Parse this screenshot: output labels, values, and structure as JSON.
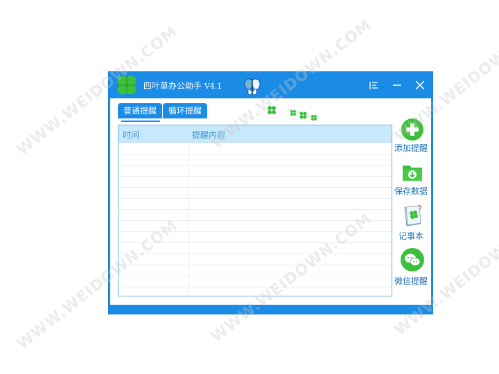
{
  "window": {
    "title": "四叶草办公助手",
    "version": "V4.1",
    "controls": {
      "menu_icon": "menu-lines-icon",
      "minimize_icon": "minimize-icon",
      "close_icon": "close-icon"
    }
  },
  "tabs": [
    {
      "label": "普通提醒",
      "active": true
    },
    {
      "label": "循环提醒",
      "active": false
    }
  ],
  "table": {
    "columns": [
      "时间",
      "提醒内容"
    ],
    "rows": []
  },
  "sidebar": [
    {
      "label": "添加提醒",
      "icon": "plus-circle-icon"
    },
    {
      "label": "保存数据",
      "icon": "folder-download-icon"
    },
    {
      "label": "记事本",
      "icon": "notebook-icon"
    },
    {
      "label": "微信提醒",
      "icon": "wechat-icon"
    }
  ],
  "watermark": "WWW.WEIDOWN.COM",
  "colors": {
    "accent": "#1a8ce6",
    "header_bg": "#c8e9fb",
    "green": "#3cbf3c",
    "label_blue": "#1a6fb8"
  }
}
